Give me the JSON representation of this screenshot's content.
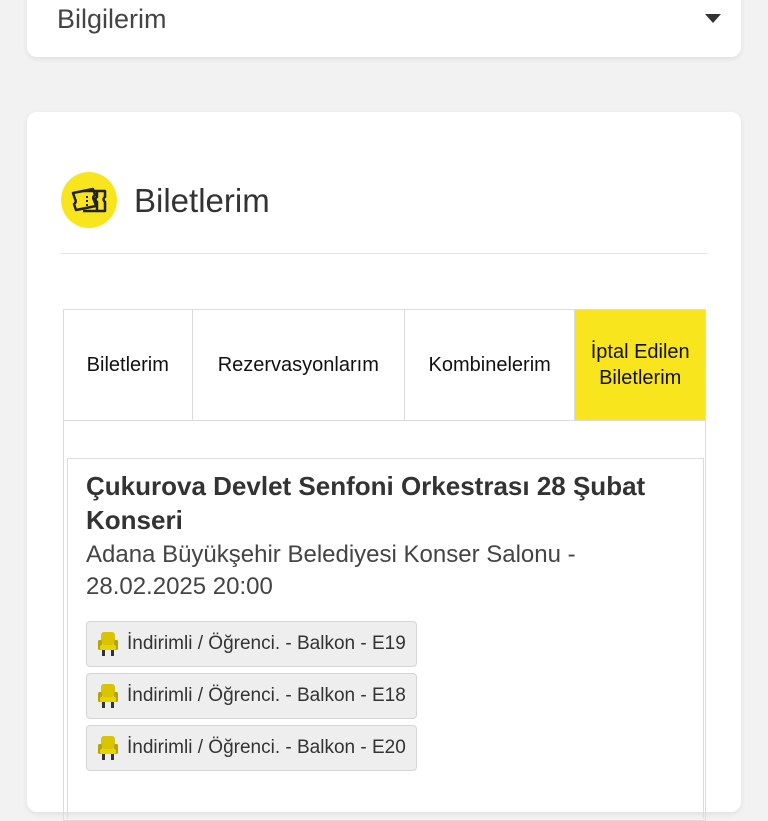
{
  "top_card": {
    "label": "Bilgilerim"
  },
  "section": {
    "title": "Biletlerim",
    "icon": "ticket-icon"
  },
  "tabs": [
    {
      "label": "Biletlerim",
      "active": false
    },
    {
      "label": "Rezervasyonlarım",
      "active": false
    },
    {
      "label": "Kombinelerim",
      "active": false
    },
    {
      "label": "İptal Edilen Biletlerim",
      "active": true
    }
  ],
  "ticket": {
    "title": "Çukurova Devlet Senfoni Orkestrası 28 Şubat Konseri",
    "venue": "Adana Büyükşehir Belediyesi Konser Salonu - 28.02.2025 20:00",
    "seats": [
      {
        "label": "İndirimli / Öğrenci. - Balkon - E19",
        "icon": "seat-icon"
      },
      {
        "label": "İndirimli / Öğrenci. - Balkon - E18",
        "icon": "seat-icon"
      },
      {
        "label": "İndirimli / Öğrenci. - Balkon - E20",
        "icon": "seat-icon"
      }
    ]
  },
  "colors": {
    "accent": "#f9e51e",
    "background": "#f2f2f2",
    "seat_icon": "#d8c400"
  }
}
